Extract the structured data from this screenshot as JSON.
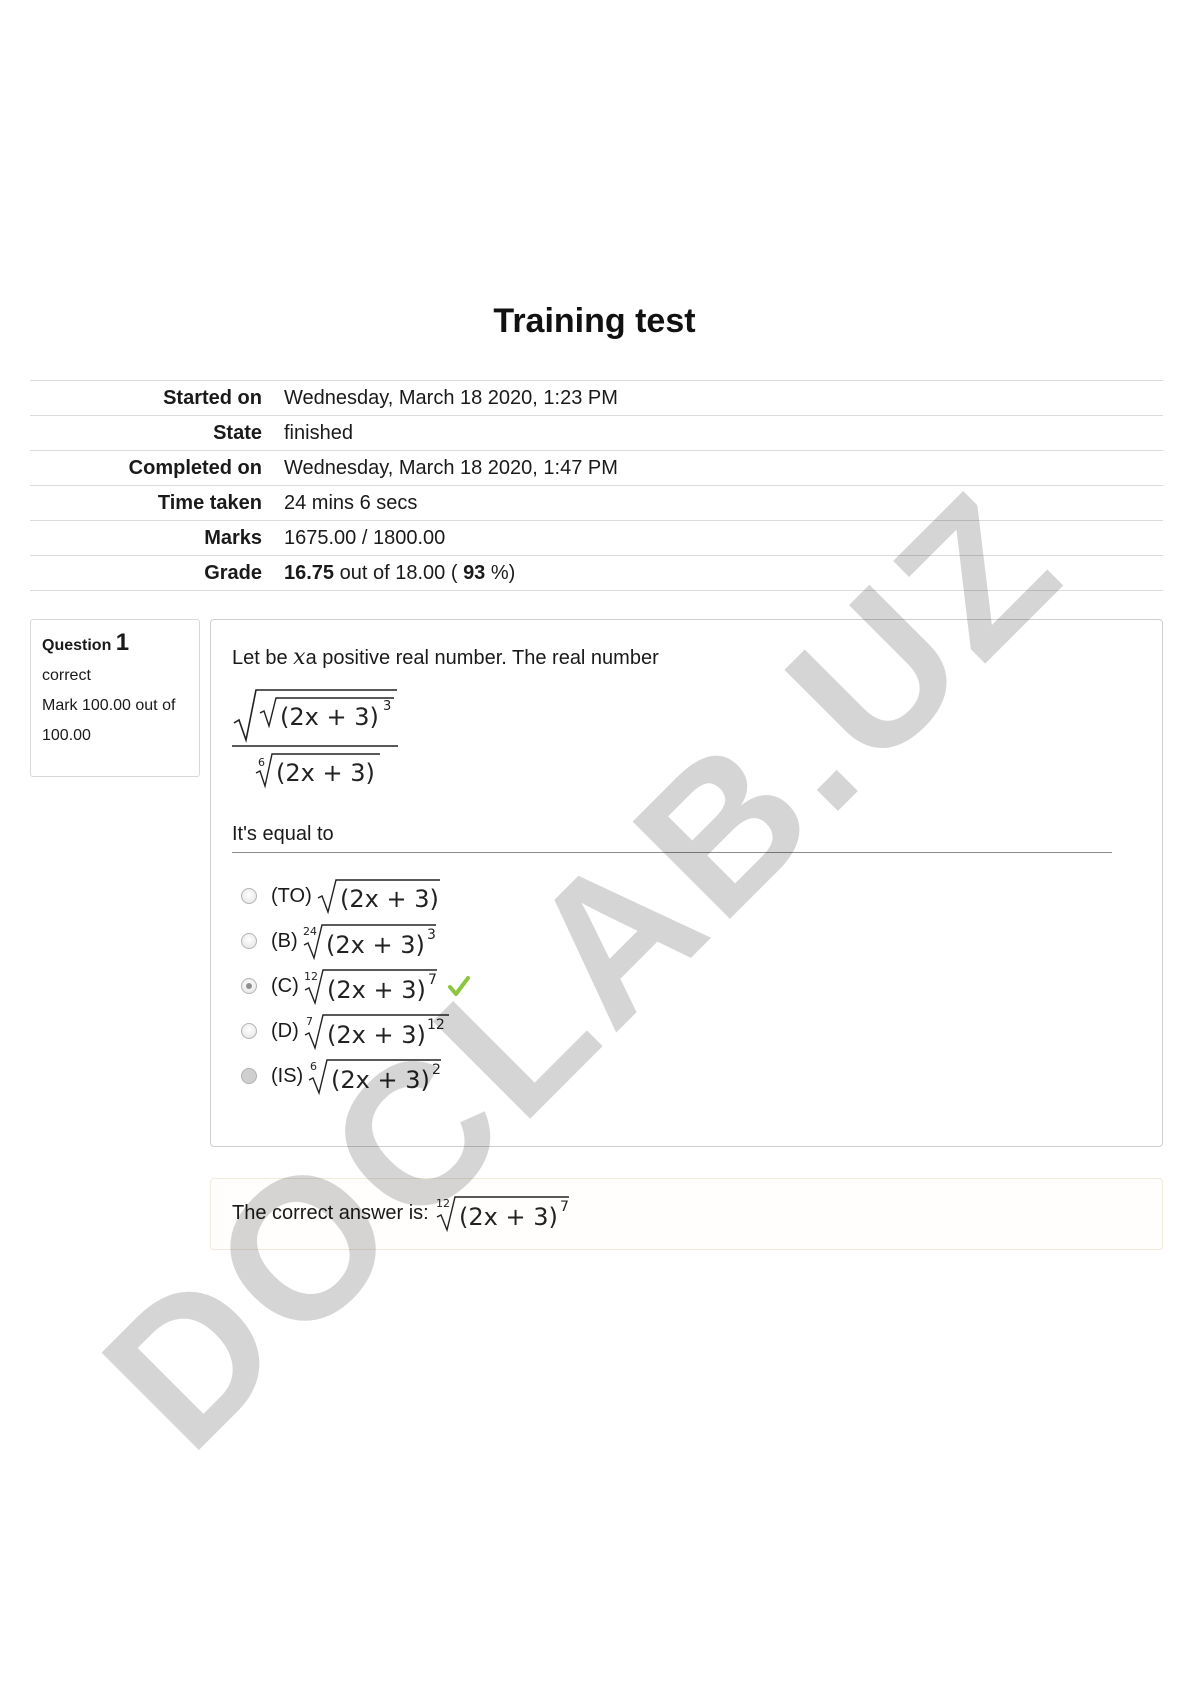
{
  "title": "Training test",
  "summary": [
    {
      "label": "Started on",
      "value": "Wednesday, March 18 2020, 1:23 PM"
    },
    {
      "label": "State",
      "value": "finished"
    },
    {
      "label": "Completed on",
      "value": "Wednesday, March 18 2020, 1:47 PM"
    },
    {
      "label": "Time taken",
      "value": "24 mins 6 secs"
    },
    {
      "label": "Marks",
      "value": "1675.00 / 1800.00"
    }
  ],
  "grade": {
    "label": "Grade",
    "score": "16.75",
    "out_of_text": "out of 18.00 (",
    "percent": "93",
    "percent_suffix": "%)"
  },
  "question": {
    "label": "Question",
    "number": "1",
    "status": "correct",
    "mark": "Mark 100.00 out of 100.00",
    "text_before": "Let be",
    "variable": "x",
    "text_after": "a positive real number. The real number",
    "equal_text": "It's equal to",
    "expression": {
      "numerator_exponent": "3",
      "denominator_index": "6",
      "base": "(2x + 3)"
    },
    "options": [
      {
        "label": "(TO)",
        "index": "",
        "exponent": "",
        "selected": false
      },
      {
        "label": "(B)",
        "index": "24",
        "exponent": "3",
        "selected": false
      },
      {
        "label": "(C)",
        "index": "12",
        "exponent": "7",
        "selected": true,
        "correct": true
      },
      {
        "label": "(D)",
        "index": "7",
        "exponent": "12",
        "selected": false
      },
      {
        "label": "(IS)",
        "index": "6",
        "exponent": "2",
        "selected": false
      }
    ]
  },
  "feedback": {
    "text": "The correct answer is:",
    "index": "12",
    "exponent": "7",
    "base": "(2x + 3)"
  },
  "watermark": "DOCLAB.UZ",
  "colors": {
    "check": "#8cc63f",
    "border": "#d8d8d8"
  }
}
